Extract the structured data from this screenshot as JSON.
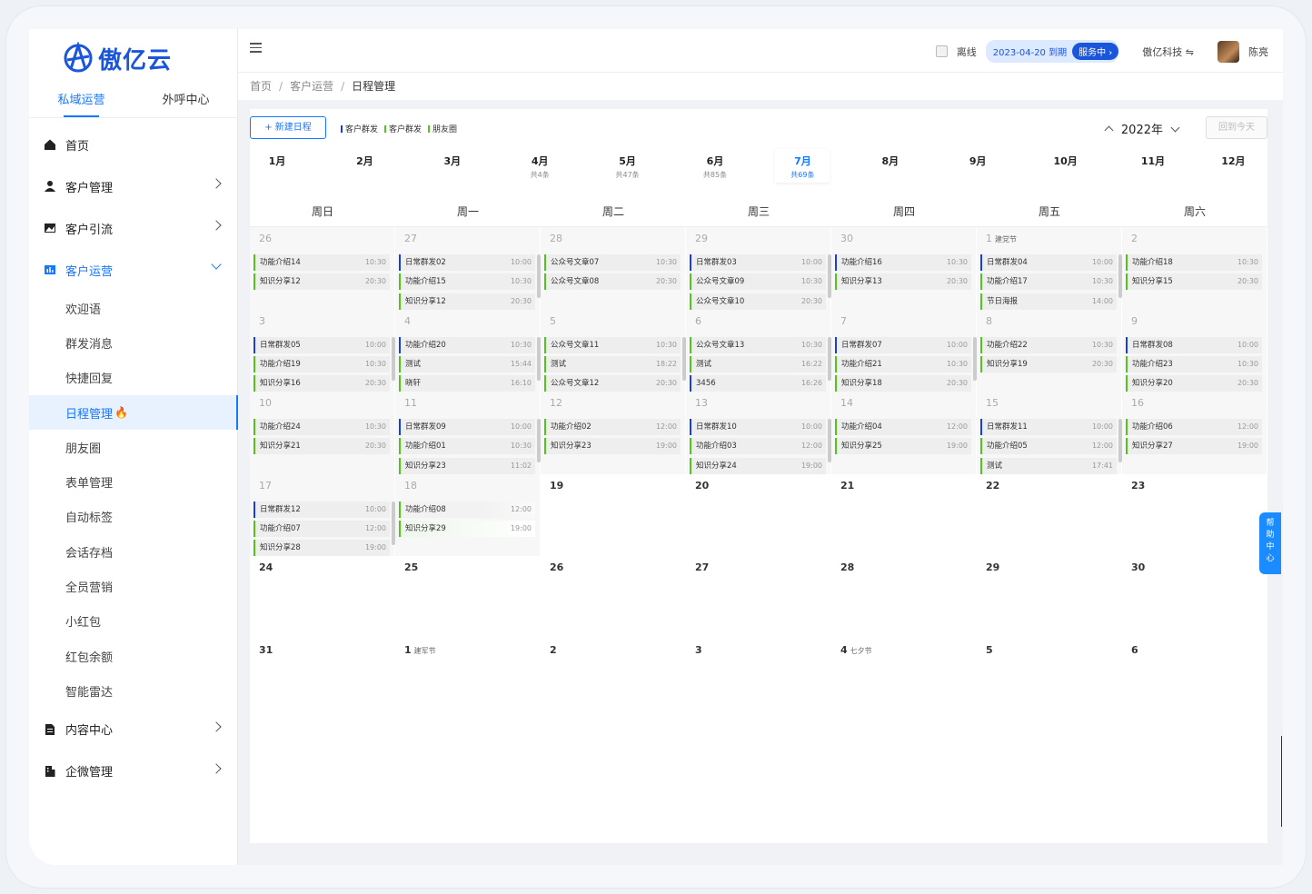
{
  "app": {
    "logo_text": "傲亿云",
    "top_tabs": [
      {
        "label": "私域运营",
        "active": true
      },
      {
        "label": "外呼中心",
        "active": false
      }
    ]
  },
  "sidebar": {
    "menu_top": [
      {
        "label": "首页",
        "icon": "home-icon",
        "has_arrow": false
      },
      {
        "label": "客户管理",
        "icon": "user-icon",
        "has_arrow": true
      },
      {
        "label": "客户引流",
        "icon": "image-icon",
        "has_arrow": true
      },
      {
        "label": "客户运营",
        "icon": "chart-icon",
        "has_arrow": true,
        "open": true
      }
    ],
    "submenu": [
      {
        "label": "欢迎语"
      },
      {
        "label": "群发消息"
      },
      {
        "label": "快捷回复"
      },
      {
        "label": "日程管理",
        "active": true,
        "badge_icon": "fire-icon"
      },
      {
        "label": "朋友圈"
      },
      {
        "label": "表单管理"
      },
      {
        "label": "自动标签"
      },
      {
        "label": "会话存档"
      },
      {
        "label": "全员营销"
      },
      {
        "label": "小红包"
      },
      {
        "label": "红包余额"
      },
      {
        "label": "智能雷达"
      }
    ],
    "menu_bottom": [
      {
        "label": "内容中心",
        "icon": "document-icon",
        "has_arrow": true
      },
      {
        "label": "企微管理",
        "icon": "building-icon",
        "has_arrow": true
      }
    ]
  },
  "header": {
    "status": "离线",
    "expire": "2023-04-20 到期",
    "service": "服务中 ›",
    "company": "傲亿科技 ⇋",
    "user": "陈亮"
  },
  "breadcrumb": [
    "首页",
    "客户运营",
    "日程管理"
  ],
  "toolbar": {
    "new_button": "+ 新建日程",
    "legend": [
      {
        "label": "客户群发",
        "color": "#1a3fd6"
      },
      {
        "label": "客户群发",
        "color": "#52c41a"
      },
      {
        "label": "朋友圈",
        "color": "#52c41a"
      }
    ],
    "year": "2022年",
    "today_button": "回到今天"
  },
  "months": [
    {
      "name": "1月",
      "count": ""
    },
    {
      "name": "2月",
      "count": ""
    },
    {
      "name": "3月",
      "count": ""
    },
    {
      "name": "4月",
      "count": "共4条"
    },
    {
      "name": "5月",
      "count": "共47条"
    },
    {
      "name": "6月",
      "count": "共85条"
    },
    {
      "name": "7月",
      "count": "共69条",
      "active": true
    },
    {
      "name": "8月",
      "count": ""
    },
    {
      "name": "9月",
      "count": ""
    },
    {
      "name": "10月",
      "count": ""
    },
    {
      "name": "11月",
      "count": ""
    },
    {
      "name": "12月",
      "count": ""
    }
  ],
  "weekdays": [
    "周日",
    "周一",
    "周二",
    "周三",
    "周四",
    "周五",
    "周六"
  ],
  "calendar": {
    "weeks": [
      [
        {
          "d": "26",
          "other": true,
          "events": [
            {
              "n": "功能介绍14",
              "t": "10:30",
              "c": "g"
            },
            {
              "n": "知识分享12",
              "t": "20:30",
              "c": "g"
            }
          ]
        },
        {
          "d": "27",
          "other": true,
          "events": [
            {
              "n": "日常群发02",
              "t": "10:00",
              "c": "b"
            },
            {
              "n": "功能介绍15",
              "t": "10:30",
              "c": "g"
            },
            {
              "n": "知识分享12",
              "t": "20:30",
              "c": "g"
            }
          ]
        },
        {
          "d": "28",
          "other": true,
          "events": [
            {
              "n": "公众号文章07",
              "t": "10:30",
              "c": "g"
            },
            {
              "n": "公众号文章08",
              "t": "20:30",
              "c": "g"
            }
          ]
        },
        {
          "d": "29",
          "other": true,
          "events": [
            {
              "n": "日常群发03",
              "t": "10:00",
              "c": "b"
            },
            {
              "n": "公众号文章09",
              "t": "10:30",
              "c": "g"
            },
            {
              "n": "公众号文章10",
              "t": "20:30",
              "c": "g"
            }
          ]
        },
        {
          "d": "30",
          "other": true,
          "events": [
            {
              "n": "功能介绍16",
              "t": "10:30",
              "c": "b"
            },
            {
              "n": "知识分享13",
              "t": "20:30",
              "c": "g"
            }
          ]
        },
        {
          "d": "1",
          "fest": "建党节",
          "other": true,
          "events": [
            {
              "n": "日常群发04",
              "t": "10:00",
              "c": "b"
            },
            {
              "n": "功能介绍17",
              "t": "10:30",
              "c": "g"
            },
            {
              "n": "节日海报",
              "t": "14:00",
              "c": "g"
            }
          ]
        },
        {
          "d": "2",
          "other": true,
          "events": [
            {
              "n": "功能介绍18",
              "t": "10:30",
              "c": "g"
            },
            {
              "n": "知识分享15",
              "t": "20:30",
              "c": "g"
            }
          ]
        }
      ],
      [
        {
          "d": "3",
          "other": true,
          "events": [
            {
              "n": "日常群发05",
              "t": "10:00",
              "c": "b"
            },
            {
              "n": "功能介绍19",
              "t": "10:30",
              "c": "g"
            },
            {
              "n": "知识分享16",
              "t": "20:30",
              "c": "g"
            }
          ]
        },
        {
          "d": "4",
          "other": true,
          "events": [
            {
              "n": "功能介绍20",
              "t": "10:30",
              "c": "b"
            },
            {
              "n": "测试",
              "t": "15:44",
              "c": "g"
            },
            {
              "n": "晓轩",
              "t": "16:10",
              "c": "g"
            }
          ]
        },
        {
          "d": "5",
          "other": true,
          "events": [
            {
              "n": "公众号文章11",
              "t": "10:30",
              "c": "g"
            },
            {
              "n": "测试",
              "t": "18:22",
              "c": "g"
            },
            {
              "n": "公众号文章12",
              "t": "20:30",
              "c": "g"
            }
          ]
        },
        {
          "d": "6",
          "other": true,
          "events": [
            {
              "n": "公众号文章13",
              "t": "10:30",
              "c": "g"
            },
            {
              "n": "测试",
              "t": "16:22",
              "c": "g"
            },
            {
              "n": "3456",
              "t": "16:26",
              "c": "b"
            }
          ]
        },
        {
          "d": "7",
          "other": true,
          "events": [
            {
              "n": "日常群发07",
              "t": "10:00",
              "c": "b"
            },
            {
              "n": "功能介绍21",
              "t": "10:30",
              "c": "g"
            },
            {
              "n": "知识分享18",
              "t": "20:30",
              "c": "g"
            }
          ]
        },
        {
          "d": "8",
          "other": true,
          "events": [
            {
              "n": "功能介绍22",
              "t": "10:30",
              "c": "g"
            },
            {
              "n": "知识分享19",
              "t": "20:30",
              "c": "g"
            }
          ]
        },
        {
          "d": "9",
          "other": true,
          "events": [
            {
              "n": "日常群发08",
              "t": "10:00",
              "c": "b"
            },
            {
              "n": "功能介绍23",
              "t": "10:30",
              "c": "g"
            },
            {
              "n": "知识分享20",
              "t": "20:30",
              "c": "g"
            }
          ]
        }
      ],
      [
        {
          "d": "10",
          "other": true,
          "events": [
            {
              "n": "功能介绍24",
              "t": "10:30",
              "c": "g"
            },
            {
              "n": "知识分享21",
              "t": "20:30",
              "c": "g"
            }
          ]
        },
        {
          "d": "11",
          "other": true,
          "events": [
            {
              "n": "日常群发09",
              "t": "10:00",
              "c": "b"
            },
            {
              "n": "功能介绍01",
              "t": "10:30",
              "c": "g"
            },
            {
              "n": "知识分享23",
              "t": "11:02",
              "c": "g"
            }
          ]
        },
        {
          "d": "12",
          "other": true,
          "events": [
            {
              "n": "功能介绍02",
              "t": "12:00",
              "c": "g"
            },
            {
              "n": "知识分享23",
              "t": "19:00",
              "c": "g"
            }
          ]
        },
        {
          "d": "13",
          "other": true,
          "events": [
            {
              "n": "日常群发10",
              "t": "10:00",
              "c": "b"
            },
            {
              "n": "功能介绍03",
              "t": "12:00",
              "c": "g"
            },
            {
              "n": "知识分享24",
              "t": "19:00",
              "c": "g"
            }
          ]
        },
        {
          "d": "14",
          "other": true,
          "events": [
            {
              "n": "功能介绍04",
              "t": "12:00",
              "c": "g"
            },
            {
              "n": "知识分享25",
              "t": "19:00",
              "c": "g"
            }
          ]
        },
        {
          "d": "15",
          "other": true,
          "events": [
            {
              "n": "日常群发11",
              "t": "10:00",
              "c": "b"
            },
            {
              "n": "功能介绍05",
              "t": "12:00",
              "c": "g"
            },
            {
              "n": "测试",
              "t": "17:41",
              "c": "g"
            }
          ]
        },
        {
          "d": "16",
          "other": true,
          "events": [
            {
              "n": "功能介绍06",
              "t": "12:00",
              "c": "g"
            },
            {
              "n": "知识分享27",
              "t": "19:00",
              "c": "g"
            }
          ]
        }
      ],
      [
        {
          "d": "17",
          "other": true,
          "events": [
            {
              "n": "日常群发12",
              "t": "10:00",
              "c": "b"
            },
            {
              "n": "功能介绍07",
              "t": "12:00",
              "c": "g"
            },
            {
              "n": "知识分享28",
              "t": "19:00",
              "c": "g"
            }
          ]
        },
        {
          "d": "18",
          "today": true,
          "other": true,
          "events": [
            {
              "n": "功能介绍08",
              "t": "12:00",
              "c": "g",
              "faded": true
            },
            {
              "n": "知识分享29",
              "t": "19:00",
              "c": "g",
              "light": true
            }
          ]
        },
        {
          "d": "19",
          "events": []
        },
        {
          "d": "20",
          "events": []
        },
        {
          "d": "21",
          "events": []
        },
        {
          "d": "22",
          "events": []
        },
        {
          "d": "23",
          "events": []
        }
      ],
      [
        {
          "d": "24",
          "events": []
        },
        {
          "d": "25",
          "events": []
        },
        {
          "d": "26",
          "events": []
        },
        {
          "d": "27",
          "events": []
        },
        {
          "d": "28",
          "events": []
        },
        {
          "d": "29",
          "events": []
        },
        {
          "d": "30",
          "events": []
        }
      ],
      [
        {
          "d": "31",
          "events": []
        },
        {
          "d": "1",
          "fest": "建军节",
          "events": []
        },
        {
          "d": "2",
          "events": []
        },
        {
          "d": "3",
          "events": []
        },
        {
          "d": "4",
          "fest": "七夕节",
          "events": []
        },
        {
          "d": "5",
          "events": []
        },
        {
          "d": "6",
          "events": []
        }
      ]
    ]
  },
  "help": [
    "帮",
    "助",
    "中",
    "心"
  ]
}
